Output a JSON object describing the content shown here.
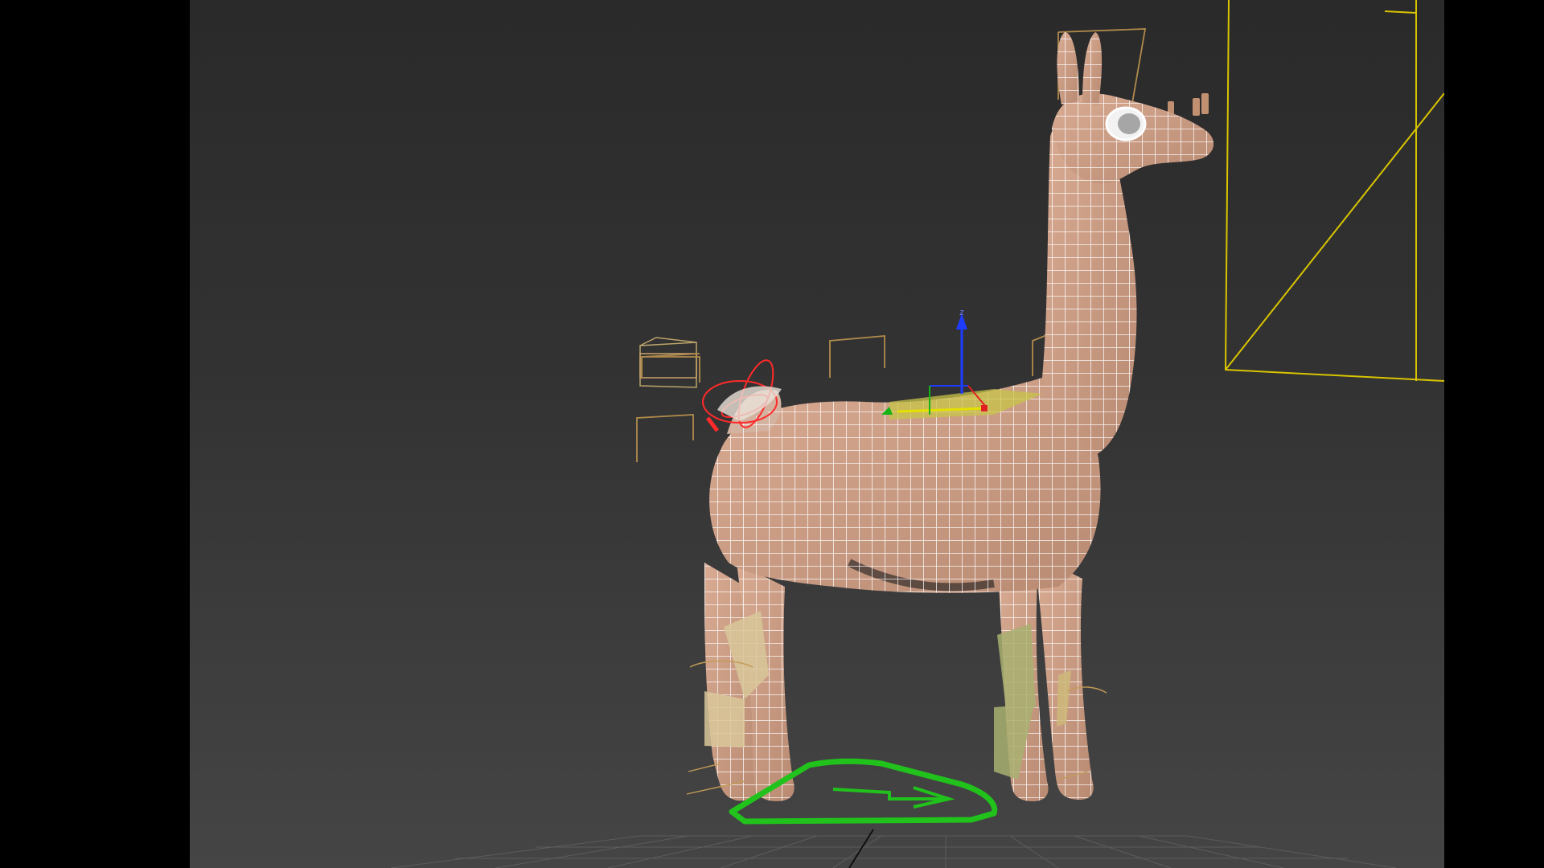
{
  "viewport": {
    "label": "",
    "gizmo": {
      "z_axis_label": "z"
    },
    "colors": {
      "background_top": "#2a2a2a",
      "background_bottom": "#454545",
      "mesh_fill": "#c79a84",
      "wireframe": "#ffffff",
      "camera_frame": "#d8c400",
      "control_ring": "#21c21c",
      "bone": "#bba46a",
      "tail_gizmo": "#ff2a2a",
      "axis_z": "#1e3cff",
      "axis_x": "#e02020",
      "axis_y": "#14b414"
    }
  },
  "scene": {
    "object": "llama-rigged-mesh",
    "controls": [
      "tail-rotate-gizmo",
      "root-control-ring",
      "move-gizmo"
    ]
  }
}
